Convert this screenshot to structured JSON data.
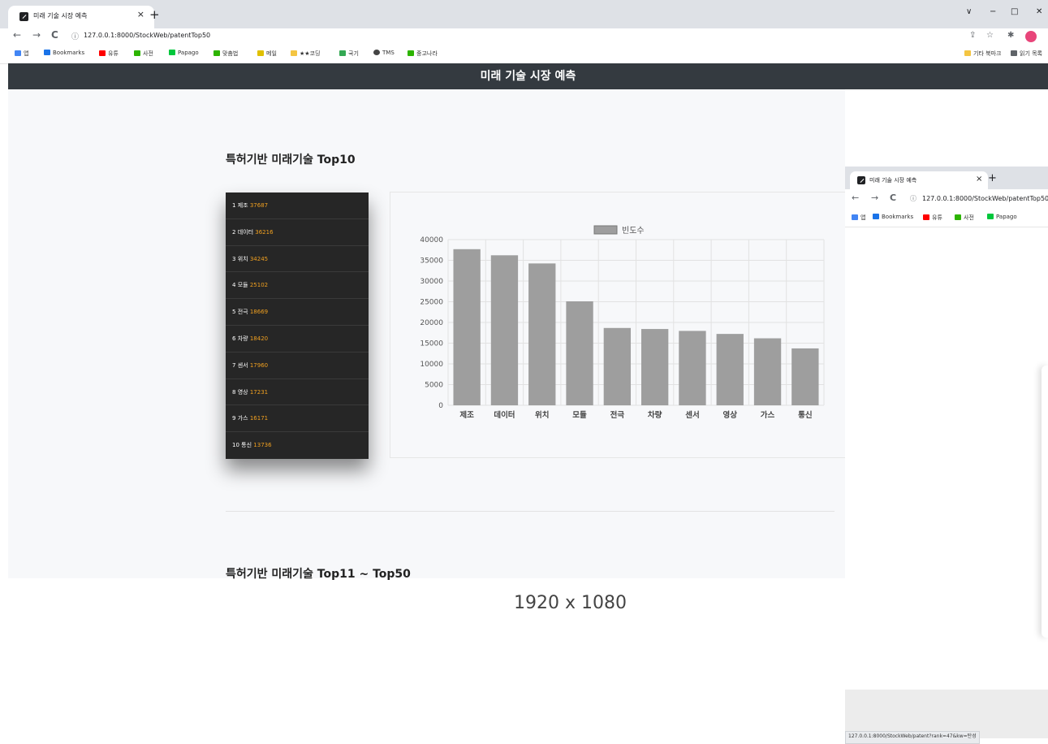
{
  "browser": {
    "tab_title": "미래 기술 시장 예측",
    "tab_close": "×",
    "new_tab": "+",
    "win_minimize_caret": "∨",
    "win_minimize": "−",
    "win_restore": "□",
    "win_close": "✕",
    "back": "←",
    "forward": "→",
    "reload": "C",
    "info_icon": "ⓘ",
    "url": "127.0.0.1:8000/StockWeb/patentTop50",
    "bookmarks": [
      {
        "label": "앱",
        "color": "#4285f4"
      },
      {
        "label": "Bookmarks",
        "color": "#1a73e8"
      },
      {
        "label": "유튜",
        "color": "#ff0000"
      },
      {
        "label": "사전",
        "color": "#2db400"
      },
      {
        "label": "Papago",
        "color": "#00c73c"
      },
      {
        "label": "맞춤법",
        "color": "#2db400"
      },
      {
        "label": "메일",
        "color": "#e0c000"
      },
      {
        "label": "★★코딩",
        "color": "#f4c542"
      },
      {
        "label": "국기",
        "color": "#34a853"
      },
      {
        "label": "TMS",
        "color": "#444444"
      },
      {
        "label": "중고나라",
        "color": "#2db400"
      }
    ],
    "bookmarks_right": [
      {
        "label": "기타 북마크",
        "color": "#f4c542"
      },
      {
        "label": "읽기 목록",
        "color": "#5f6368"
      }
    ]
  },
  "page": {
    "header_title": "미래 기술 시장 예측",
    "section1_title": "특허기반 미래기술 Top10",
    "section2_title": "특허기반 미래기술 Top11 ~ Top50",
    "size_caption": "1920 x 1080"
  },
  "top10": [
    {
      "rank": "1",
      "name": "제조",
      "count": "37687"
    },
    {
      "rank": "2",
      "name": "데이터",
      "count": "36216"
    },
    {
      "rank": "3",
      "name": "위치",
      "count": "34245"
    },
    {
      "rank": "4",
      "name": "모듈",
      "count": "25102"
    },
    {
      "rank": "5",
      "name": "전극",
      "count": "18669"
    },
    {
      "rank": "6",
      "name": "차량",
      "count": "18420"
    },
    {
      "rank": "7",
      "name": "센서",
      "count": "17960"
    },
    {
      "rank": "8",
      "name": "영상",
      "count": "17231"
    },
    {
      "rank": "9",
      "name": "가스",
      "count": "16171"
    },
    {
      "rank": "10",
      "name": "통신",
      "count": "13736"
    }
  ],
  "chart_data": {
    "type": "bar",
    "categories": [
      "제조",
      "데이터",
      "위치",
      "모듈",
      "전극",
      "차량",
      "센서",
      "영상",
      "가스",
      "통신"
    ],
    "series": [
      {
        "name": "빈도수",
        "values": [
          37687,
          36216,
          34245,
          25102,
          18669,
          18420,
          17960,
          17231,
          16171,
          13736
        ]
      }
    ],
    "yticks": [
      "40000",
      "35000",
      "30000",
      "25000",
      "20000",
      "15000",
      "10000",
      "5000",
      "0"
    ],
    "ylim": [
      0,
      40000
    ],
    "grid": true,
    "legend_position": "top",
    "bar_color": "#9e9e9e"
  },
  "second_window": {
    "tab_title": "미래 기술 시장 예측",
    "tab_close": "×",
    "new_tab": "+",
    "url": "127.0.0.1:8000/StockWeb/patentTop50",
    "bookmarks": [
      {
        "label": "앱",
        "color": "#4285f4"
      },
      {
        "label": "Bookmarks",
        "color": "#1a73e8"
      },
      {
        "label": "유튜",
        "color": "#ff0000"
      },
      {
        "label": "사전",
        "color": "#2db400"
      },
      {
        "label": "Papago",
        "color": "#00c73c"
      }
    ],
    "status_url": "127.0.0.1:8000/StockWeb/patent?rank=47&kw=탄성"
  }
}
